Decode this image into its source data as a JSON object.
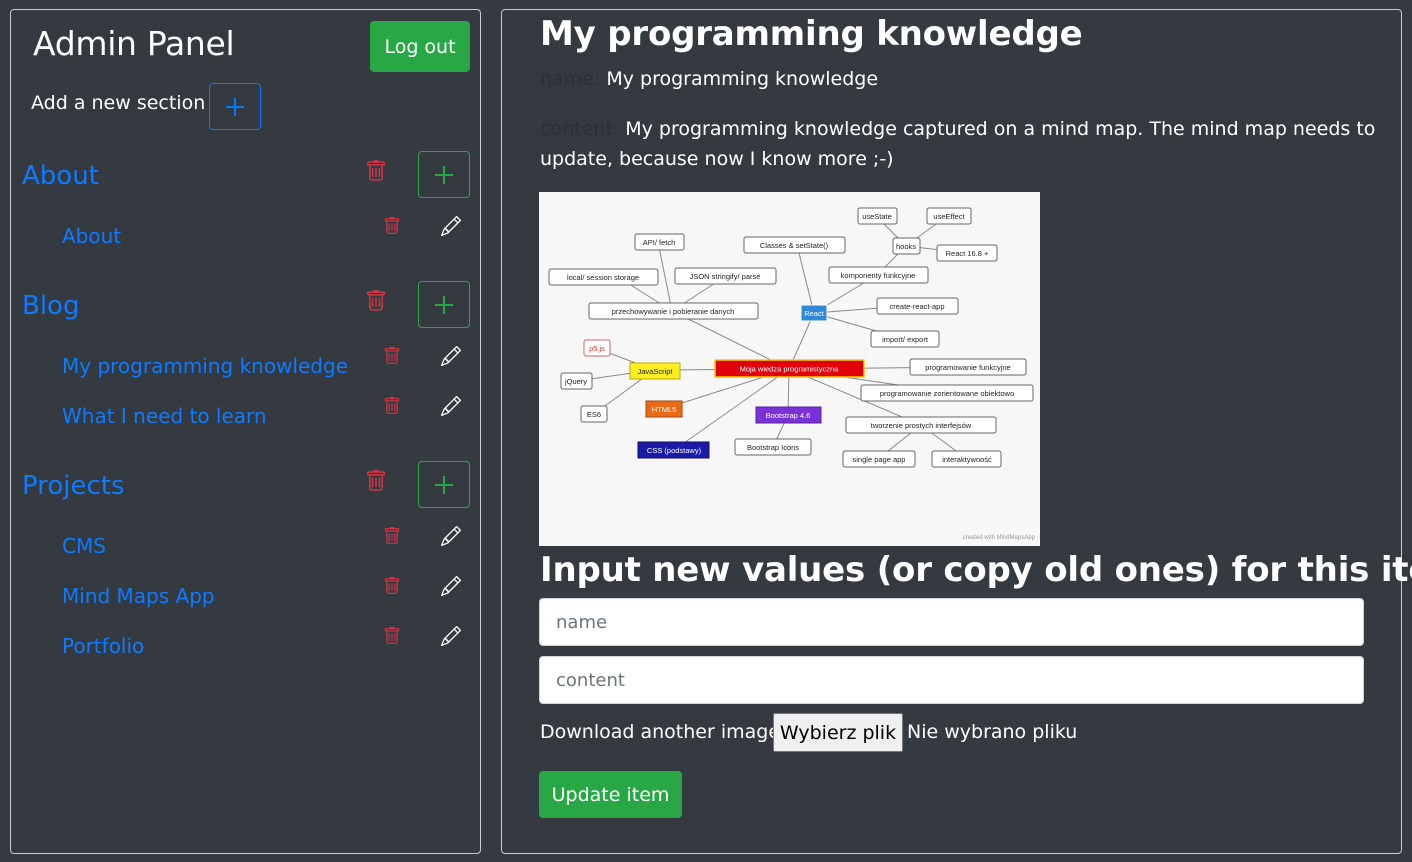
{
  "sidebar": {
    "title": "Admin Panel",
    "logout_label": "Log out",
    "add_section_label": "Add a new section",
    "sections": [
      {
        "title": "About",
        "items": [
          "About"
        ]
      },
      {
        "title": "Blog",
        "items": [
          "My programming knowledge",
          "What I need to learn"
        ]
      },
      {
        "title": "Projects",
        "items": [
          "CMS",
          "Mind Maps App",
          "Portfolio"
        ]
      }
    ]
  },
  "main": {
    "title": "My programming knowledge",
    "name_key": "name:",
    "name_value": "My programming knowledge",
    "content_key": "content:",
    "content_value": "My programming knowledge captured on a mind map. The mind map needs to update, because now I know more ;-)",
    "form_title": "Input new values (or copy old ones) for this item!",
    "name_placeholder": "name",
    "content_placeholder": "content",
    "download_label": "Download another image:",
    "file_button_label": "Wybierz plik",
    "file_status": "Nie wybrano pliku",
    "update_label": "Update item"
  },
  "mindmap": {
    "nodes": {
      "center": "Moja wiedza programistyczna",
      "react": "React",
      "usestate": "useState",
      "useeffect": "useEffect",
      "hooks": "hooks",
      "react168": "React 16.8 +",
      "classes": "Classes & setState()",
      "komponenty": "komponenty funkcyjne",
      "apifetch": "API/ fetch",
      "jsonstr": "JSON stringify/ parse",
      "localstorage": "local/ session storage",
      "przechowywanie": "przechowywanie i pobieranie danych",
      "cra": "create-react-app",
      "importexport": "import/ export",
      "p5": "p5.js",
      "javascript": "JavaScript",
      "jquery": "jQuery",
      "es6": "ES6",
      "html5": "HTML5",
      "css": "CSS (podstawy)",
      "bootstrap": "Bootstrap 4.6",
      "bootstrapicons": "Bootstrap Icons",
      "funkcyjne": "programowanie funkcyjne",
      "obiektowe": "programowanie zorientowane obiektowo",
      "interfejsy": "tworzenie prostych interfejsów",
      "spa": "single page app",
      "interaktywnosc": "interaktywność",
      "credit": "created with MindMapsApp"
    }
  },
  "colors": {
    "background": "#343a40",
    "link": "#0d7bff",
    "success": "#28a745",
    "danger": "#dc3545"
  }
}
